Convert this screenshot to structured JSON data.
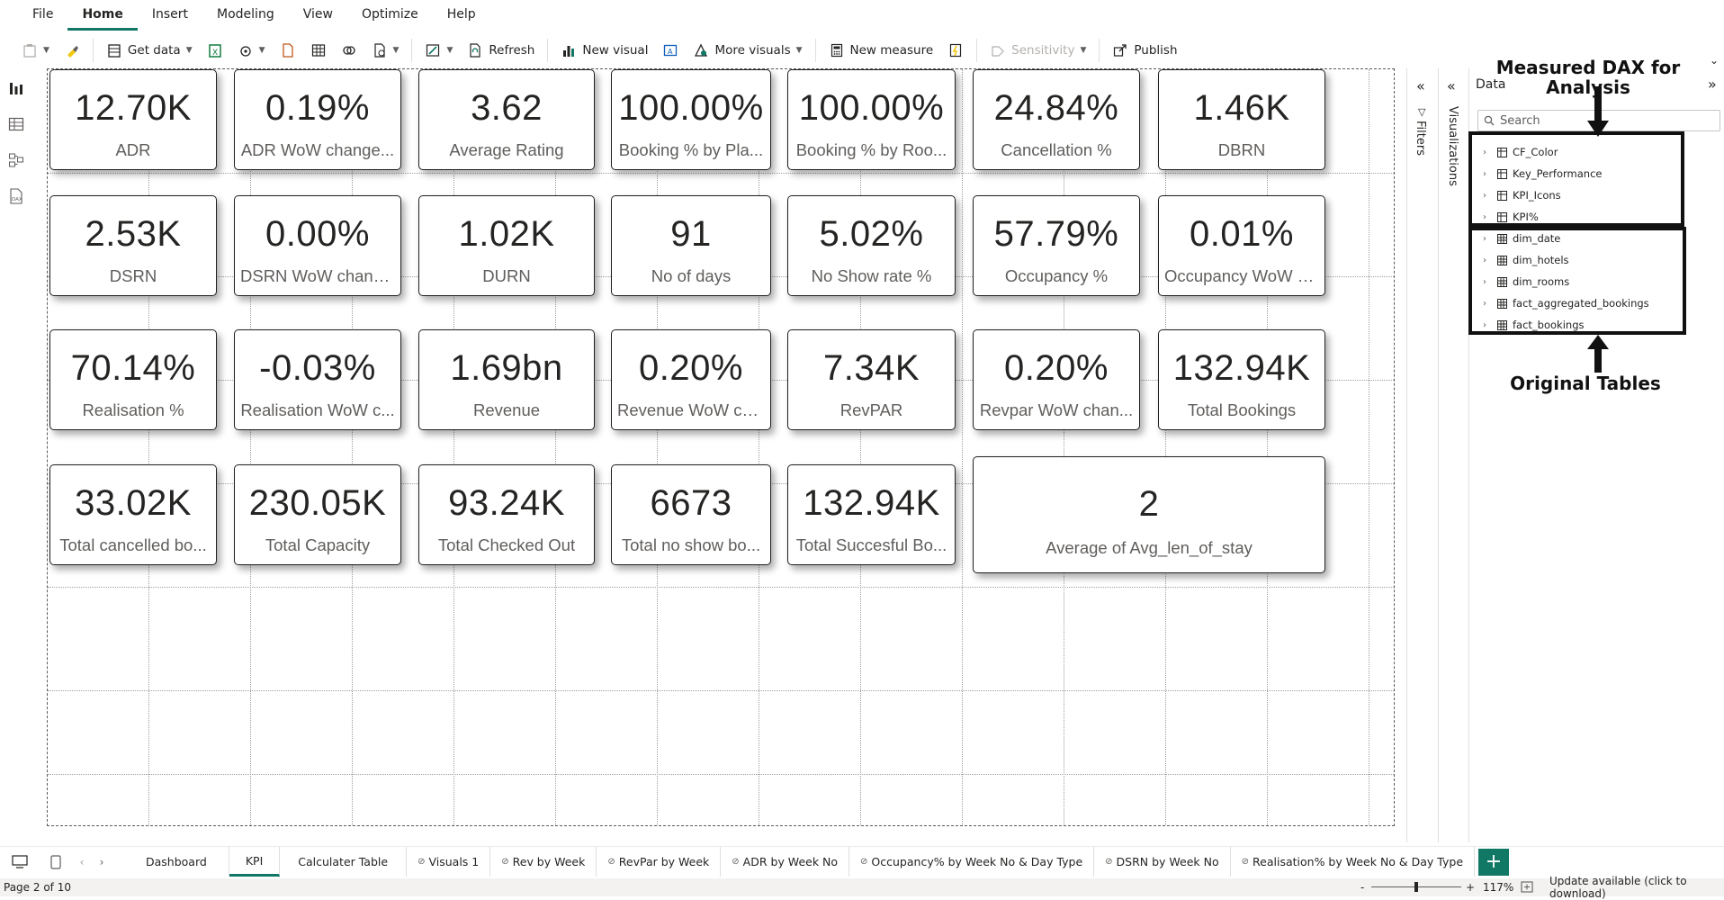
{
  "menu": [
    "File",
    "Home",
    "Insert",
    "Modeling",
    "View",
    "Optimize",
    "Help"
  ],
  "menu_active": "Home",
  "ribbon": {
    "get_data": "Get data",
    "refresh": "Refresh",
    "new_visual": "New visual",
    "more_visuals": "More visuals",
    "new_measure": "New measure",
    "sensitivity": "Sensitivity",
    "publish": "Publish"
  },
  "cards": [
    {
      "value": "12.70K",
      "label": "ADR"
    },
    {
      "value": "0.19%",
      "label": "ADR WoW change..."
    },
    {
      "value": "3.62",
      "label": "Average Rating"
    },
    {
      "value": "100.00%",
      "label": "Booking % by Pla..."
    },
    {
      "value": "100.00%",
      "label": "Booking % by Roo..."
    },
    {
      "value": "24.84%",
      "label": "Cancellation %"
    },
    {
      "value": "1.46K",
      "label": "DBRN"
    },
    {
      "value": "2.53K",
      "label": "DSRN"
    },
    {
      "value": "0.00%",
      "label": "DSRN WoW chang..."
    },
    {
      "value": "1.02K",
      "label": "DURN"
    },
    {
      "value": "91",
      "label": "No of days"
    },
    {
      "value": "5.02%",
      "label": "No Show rate %"
    },
    {
      "value": "57.79%",
      "label": "Occupancy %"
    },
    {
      "value": "0.01%",
      "label": "Occupancy WoW c..."
    },
    {
      "value": "70.14%",
      "label": "Realisation %"
    },
    {
      "value": "-0.03%",
      "label": "Realisation WoW c..."
    },
    {
      "value": "1.69bn",
      "label": "Revenue"
    },
    {
      "value": "0.20%",
      "label": "Revenue WoW ch..."
    },
    {
      "value": "7.34K",
      "label": "RevPAR"
    },
    {
      "value": "0.20%",
      "label": "Revpar WoW chan..."
    },
    {
      "value": "132.94K",
      "label": "Total Bookings"
    },
    {
      "value": "33.02K",
      "label": "Total cancelled bo..."
    },
    {
      "value": "230.05K",
      "label": "Total Capacity"
    },
    {
      "value": "93.24K",
      "label": "Total Checked Out"
    },
    {
      "value": "6673",
      "label": "Total no show bo..."
    },
    {
      "value": "132.94K",
      "label": "Total Succesful Bo..."
    },
    {
      "value": "2",
      "label": "Average of Avg_len_of_stay"
    }
  ],
  "panes": {
    "filters": "Filters",
    "visualizations": "Visualizations",
    "data": "Data",
    "search_placeholder": "Search"
  },
  "tables_measures": [
    "CF_Color",
    "Key_Performance",
    "KPI_Icons",
    "KPI%"
  ],
  "tables_original": [
    "dim_date",
    "dim_hotels",
    "dim_rooms",
    "fact_aggregated_bookings",
    "fact_bookings"
  ],
  "annotations": {
    "top": "Measured DAX for Analysis",
    "bottom": "Original Tables"
  },
  "tabs": [
    "Dashboard",
    "KPI",
    "Calculater Table",
    "Visuals 1",
    "Rev by Week",
    "RevPar by Week",
    "ADR by Week No",
    "Occupancy% by Week No & Day Type",
    "DSRN by Week No",
    "Realisation% by Week No & Day Type"
  ],
  "tab_active": "KPI",
  "status": {
    "page": "Page 2 of 10",
    "zoom": "117%",
    "zoom_minus": "-",
    "zoom_plus": "+",
    "update": "Update available (click to download)"
  },
  "colors": {
    "accent": "#117865",
    "card_border": "#1f1f1f",
    "annotation": "#111111"
  }
}
